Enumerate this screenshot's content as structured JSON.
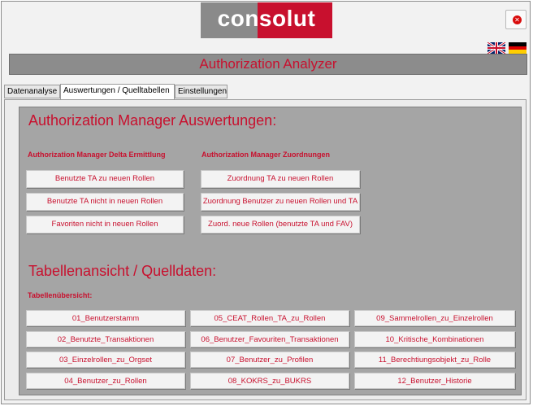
{
  "header": {
    "logo_text": "consolut",
    "logo_colors": {
      "grey": "#8a8a8a",
      "red": "#c8102e"
    },
    "close_icon": "close-circle-icon",
    "flags": [
      "uk-flag-icon",
      "germany-flag-icon"
    ]
  },
  "title_bar": {
    "title": "Authorization Analyzer"
  },
  "tabs": [
    {
      "label": "Datenanalyse",
      "active": false
    },
    {
      "label": "Auswertungen / Quelltabellen",
      "active": true
    },
    {
      "label": "Einstellungen",
      "active": false
    }
  ],
  "auth_manager": {
    "heading": "Authorization Manager Auswertungen:",
    "delta": {
      "label": "Authorization Manager Delta Ermittlung",
      "buttons": [
        "Benutzte TA zu neuen Rollen",
        "Benutzte TA nicht in neuen Rollen",
        "Favoriten nicht in neuen Rollen"
      ]
    },
    "zuordnungen": {
      "label": "Authorization Manager  Zuordnungen",
      "buttons": [
        "Zuordnung TA zu neuen Rollen",
        "Zuordnung Benutzer zu neuen Rollen und TA",
        "Zuord. neue Rollen (benutzte TA und FAV)"
      ]
    }
  },
  "tables": {
    "heading": "Tabellenansicht / Quelldaten:",
    "label": "Tabellenübersicht:",
    "buttons": [
      "01_Benutzerstamm",
      "02_Benutzte_Transaktionen",
      "03_Einzelrollen_zu_Orgset",
      "04_Benutzer_zu_Rollen",
      "05_CEAT_Rollen_TA_zu_Rollen",
      "06_Benutzer_Favouriten_Transaktionen",
      "07_Benutzer_zu_Profilen",
      "08_KOKRS_zu_BUKRS",
      "09_Sammelrollen_zu_Einzelrollen",
      "10_Kritische_Kombinationen",
      "11_Berechtiungsobjekt_zu_Rolle",
      "12_Benutzer_Historie"
    ]
  }
}
